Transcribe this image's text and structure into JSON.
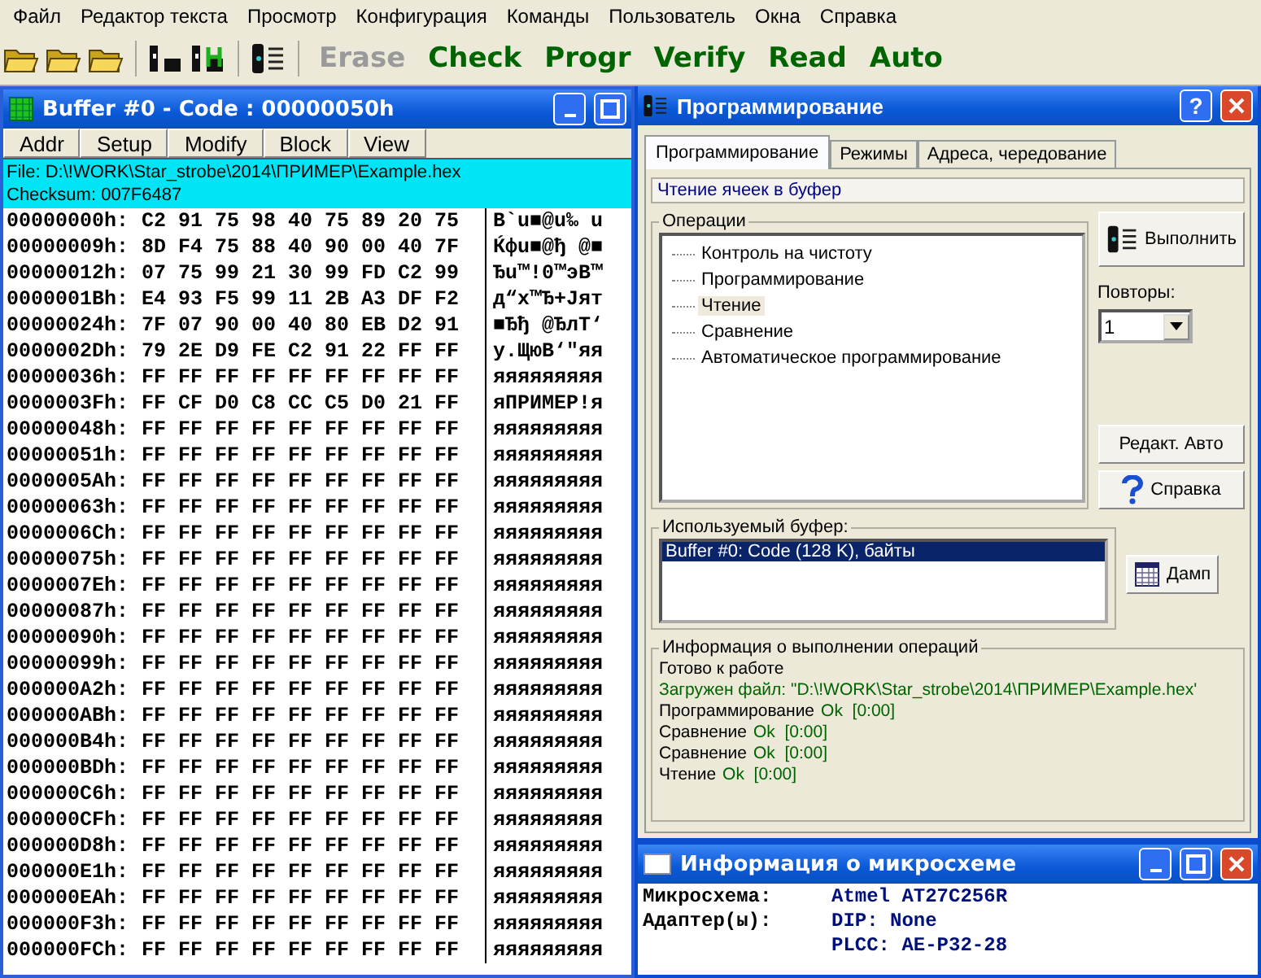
{
  "menu": [
    "Файл",
    "Редактор текста",
    "Просмотр",
    "Конфигурация",
    "Команды",
    "Пользователь",
    "Окна",
    "Справка"
  ],
  "toolbar": {
    "commands": [
      {
        "label": "Erase",
        "disabled": true
      },
      {
        "label": "Check",
        "disabled": false
      },
      {
        "label": "Progr",
        "disabled": false
      },
      {
        "label": "Verify",
        "disabled": false
      },
      {
        "label": "Read",
        "disabled": false
      },
      {
        "label": "Auto",
        "disabled": false
      }
    ]
  },
  "buffer_window": {
    "title": "Buffer #0 - Code : 00000050h",
    "buttons": [
      "Addr",
      "Setup",
      "Modify",
      "Block",
      "View"
    ],
    "file": "File: D:\\!WORK\\Star_strobe\\2014\\ПРИМЕР\\Example.hex",
    "checksum": "Checksum: 007F6487",
    "rows": [
      {
        "address": "00000000h:",
        "bytes": "C2 91 75 98 40 75 89 20 75",
        "ascii": "B`u■@u‰ u"
      },
      {
        "address": "00000009h:",
        "bytes": "8D F4 75 88 40 90 00 40 7F",
        "ascii": "Ќфu■@ђ @■"
      },
      {
        "address": "00000012h:",
        "bytes": "07 75 99 21 30 99 FD C2 99",
        "ascii": "Ђu™!0™эB™"
      },
      {
        "address": "0000001Bh:",
        "bytes": "E4 93 F5 99 11 2B A3 DF F2",
        "ascii": "д“х™Ђ+Jят"
      },
      {
        "address": "00000024h:",
        "bytes": "7F 07 90 00 40 80 EB D2 91",
        "ascii": "■Ђђ @ЂлТ‘"
      },
      {
        "address": "0000002Dh:",
        "bytes": "79 2E D9 FE C2 91 22 FF FF",
        "ascii": "y.ЩюB‘\"яя"
      },
      {
        "address": "00000036h:",
        "bytes": "FF FF FF FF FF FF FF FF FF",
        "ascii": "яяяяяяяяя"
      },
      {
        "address": "0000003Fh:",
        "bytes": "FF CF D0 C8 CC C5 D0 21 FF",
        "ascii": "яПРИМЕР!я"
      },
      {
        "address": "00000048h:",
        "bytes": "FF FF FF FF FF FF FF FF FF",
        "ascii": "яяяяяяяяя"
      },
      {
        "address": "00000051h:",
        "bytes": "FF FF FF FF FF FF FF FF FF",
        "ascii": "яяяяяяяяя"
      },
      {
        "address": "0000005Ah:",
        "bytes": "FF FF FF FF FF FF FF FF FF",
        "ascii": "яяяяяяяяя"
      },
      {
        "address": "00000063h:",
        "bytes": "FF FF FF FF FF FF FF FF FF",
        "ascii": "яяяяяяяяя"
      },
      {
        "address": "0000006Ch:",
        "bytes": "FF FF FF FF FF FF FF FF FF",
        "ascii": "яяяяяяяяя"
      },
      {
        "address": "00000075h:",
        "bytes": "FF FF FF FF FF FF FF FF FF",
        "ascii": "яяяяяяяяя"
      },
      {
        "address": "0000007Eh:",
        "bytes": "FF FF FF FF FF FF FF FF FF",
        "ascii": "яяяяяяяяя"
      },
      {
        "address": "00000087h:",
        "bytes": "FF FF FF FF FF FF FF FF FF",
        "ascii": "яяяяяяяяя"
      },
      {
        "address": "00000090h:",
        "bytes": "FF FF FF FF FF FF FF FF FF",
        "ascii": "яяяяяяяяя"
      },
      {
        "address": "00000099h:",
        "bytes": "FF FF FF FF FF FF FF FF FF",
        "ascii": "яяяяяяяяя"
      },
      {
        "address": "000000A2h:",
        "bytes": "FF FF FF FF FF FF FF FF FF",
        "ascii": "яяяяяяяяя"
      },
      {
        "address": "000000ABh:",
        "bytes": "FF FF FF FF FF FF FF FF FF",
        "ascii": "яяяяяяяяя"
      },
      {
        "address": "000000B4h:",
        "bytes": "FF FF FF FF FF FF FF FF FF",
        "ascii": "яяяяяяяяя"
      },
      {
        "address": "000000BDh:",
        "bytes": "FF FF FF FF FF FF FF FF FF",
        "ascii": "яяяяяяяяя"
      },
      {
        "address": "000000C6h:",
        "bytes": "FF FF FF FF FF FF FF FF FF",
        "ascii": "яяяяяяяяя"
      },
      {
        "address": "000000CFh:",
        "bytes": "FF FF FF FF FF FF FF FF FF",
        "ascii": "яяяяяяяяя"
      },
      {
        "address": "000000D8h:",
        "bytes": "FF FF FF FF FF FF FF FF FF",
        "ascii": "яяяяяяяяя"
      },
      {
        "address": "000000E1h:",
        "bytes": "FF FF FF FF FF FF FF FF FF",
        "ascii": "яяяяяяяяя"
      },
      {
        "address": "000000EAh:",
        "bytes": "FF FF FF FF FF FF FF FF FF",
        "ascii": "яяяяяяяяя"
      },
      {
        "address": "000000F3h:",
        "bytes": "FF FF FF FF FF FF FF FF FF",
        "ascii": "яяяяяяяяя"
      },
      {
        "address": "000000FCh:",
        "bytes": "FF FF FF FF FF FF FF FF FF",
        "ascii": "яяяяяяяяя"
      }
    ]
  },
  "dialog": {
    "title": "Программирование",
    "help_button": "?",
    "tabs": [
      {
        "label": "Программирование",
        "selected": true
      },
      {
        "label": "Режимы",
        "selected": false
      },
      {
        "label": "Адреса, чередование",
        "selected": false
      }
    ],
    "status": "Чтение ячеек в буфер",
    "operations": {
      "label": "Операции",
      "items": [
        {
          "label": "Контроль на чистоту",
          "selected": false
        },
        {
          "label": "Программирование",
          "selected": false
        },
        {
          "label": "Чтение",
          "selected": true
        },
        {
          "label": "Сравнение",
          "selected": false
        },
        {
          "label": "Автоматическое программирование",
          "selected": false
        }
      ]
    },
    "run_button": "Выполнить",
    "repeats": {
      "label": "Повторы:",
      "value": "1"
    },
    "edit_auto_button": "Редакт. Авто",
    "help_text_button": "Справка",
    "buffer": {
      "label": "Используемый буфер:",
      "items": [
        {
          "label": "Buffer #0:  Code (128 K), байты",
          "selected": true
        }
      ]
    },
    "dump_button": "Дамп",
    "log": {
      "label": "Информация о выполнении операций",
      "lines": [
        {
          "kind": "plain",
          "text": "Готово к работе"
        },
        {
          "kind": "loaded",
          "text": "Загружен файл: \"D:\\!WORK\\Star_strobe\\2014\\ПРИМЕР\\Example.hex'"
        },
        {
          "kind": "result",
          "text": "Программирование",
          "result": "Ok  [0:00]"
        },
        {
          "kind": "result",
          "text": "Сравнение",
          "result": "Ok  [0:00]"
        },
        {
          "kind": "result",
          "text": "Сравнение",
          "result": "Ok  [0:00]"
        },
        {
          "kind": "result",
          "text": "Чтение",
          "result": "Ok  [0:00]"
        }
      ]
    }
  },
  "chip_window": {
    "title": "Информация о микросхеме",
    "rows": [
      {
        "label": "Микросхема:",
        "value": "Atmel AT27C256R"
      },
      {
        "label": "Адаптер(ы):",
        "value": "DIP: None"
      },
      {
        "value": "PLCC: AE-P32-28"
      }
    ]
  }
}
